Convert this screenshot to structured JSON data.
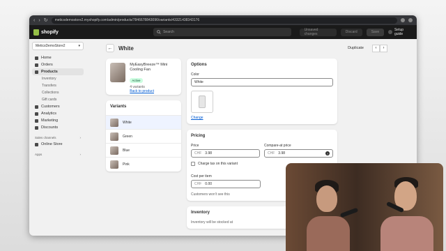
{
  "browser": {
    "url": "meticsdemostore2.myshopify.com/admin/products/7846678843096/variants/43321438343176",
    "nav_glyphs": [
      "‹",
      "›",
      "↻"
    ]
  },
  "topbar": {
    "brand": "shopify",
    "search_placeholder": "Search",
    "unsaved_label": "Unsaved changes",
    "discard_label": "Discard",
    "save_label": "Save",
    "setup_guide_label": "Setup guide"
  },
  "sidebar": {
    "store_name": "MeticsDemoStore2",
    "items": [
      {
        "label": "Home",
        "icon": "home-icon"
      },
      {
        "label": "Orders",
        "icon": "orders-icon"
      },
      {
        "label": "Products",
        "icon": "tag-icon"
      }
    ],
    "product_subitems": [
      "Inventory",
      "Transfers",
      "Collections",
      "Gift cards"
    ],
    "items2": [
      {
        "label": "Customers",
        "icon": "person-icon"
      },
      {
        "label": "Analytics",
        "icon": "chart-icon"
      },
      {
        "label": "Marketing",
        "icon": "target-icon"
      },
      {
        "label": "Discounts",
        "icon": "discount-icon"
      }
    ],
    "sales_channels_label": "Sales channels",
    "online_store_label": "Online Store",
    "apps_label": "Apps"
  },
  "page": {
    "title": "White",
    "duplicate_label": "Duplicate"
  },
  "product_card": {
    "name": "MyEasyBreeze™ Mini Cooling Fan",
    "status": "Active",
    "variants_count": "4 variants",
    "back_link": "Back to product"
  },
  "variants_card": {
    "heading": "Variants",
    "items": [
      "White",
      "Green",
      "Blue",
      "Pink"
    ]
  },
  "options_card": {
    "heading": "Options",
    "color_label": "Color",
    "color_value": "White",
    "change_label": "Change"
  },
  "pricing_card": {
    "heading": "Pricing",
    "price_label": "Price",
    "currency": "CHF",
    "price_value": "3.98",
    "compare_label": "Compare-at price",
    "compare_value": "3.98",
    "charge_tax_label": "Charge tax on this variant",
    "cost_label": "Cost per item",
    "cost_value": "0.00",
    "cost_help": "Customers won't see this"
  },
  "inventory_card": {
    "heading": "Inventory",
    "note": "Inventory will be stocked at"
  },
  "colors": {
    "accent": "#005bd3",
    "topbar": "#1a1a1a",
    "success_badge": "#cdfee1"
  }
}
